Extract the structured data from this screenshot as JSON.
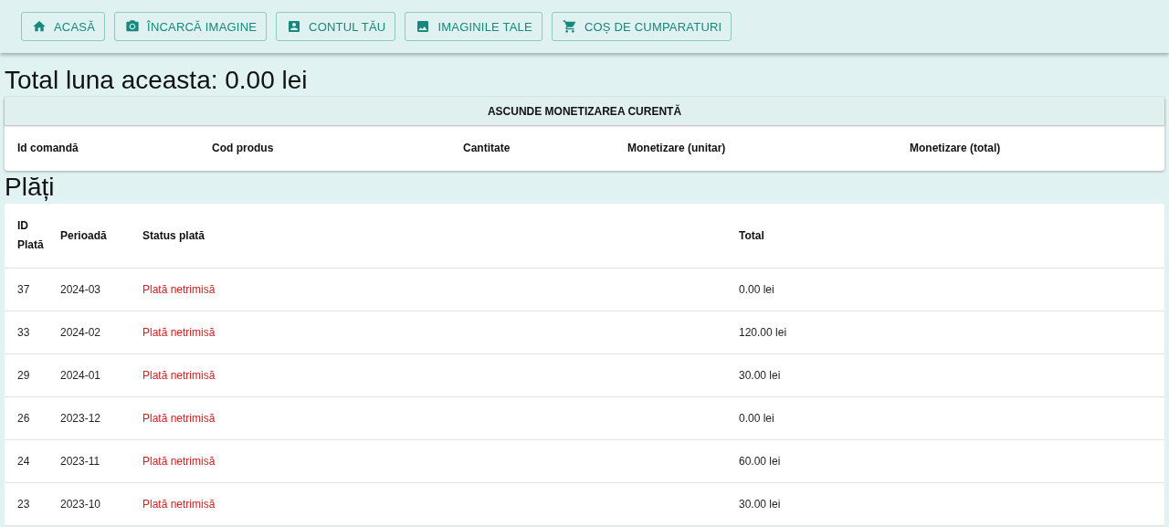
{
  "nav": [
    {
      "kind": "home",
      "label": "ACASĂ"
    },
    {
      "kind": "camera",
      "label": "ÎNCARCĂ IMAGINE"
    },
    {
      "kind": "account",
      "label": "CONTUL TĂU"
    },
    {
      "kind": "image",
      "label": "IMAGINILE TALE"
    },
    {
      "kind": "cart",
      "label": "COȘ DE CUMPARATURI"
    }
  ],
  "total_title": "Total luna aceasta: 0.00 lei",
  "monetization": {
    "toggle_label": "ASCUNDE MONETIZAREA CURENTĂ",
    "columns": [
      "Id comandă",
      "Cod produs",
      "Cantitate",
      "Monetizare (unitar)",
      "Monetizare (total)"
    ]
  },
  "payments_title": "Plăți",
  "payments": {
    "columns": [
      "ID Plată",
      "Perioadă",
      "Status plată",
      "Total"
    ],
    "rows": [
      [
        "37",
        "2024-03",
        "Plată netrimisă",
        "0.00 lei"
      ],
      [
        "33",
        "2024-02",
        "Plată netrimisă",
        "120.00 lei"
      ],
      [
        "29",
        "2024-01",
        "Plată netrimisă",
        "30.00 lei"
      ],
      [
        "26",
        "2023-12",
        "Plată netrimisă",
        "0.00 lei"
      ],
      [
        "24",
        "2023-11",
        "Plată netrimisă",
        "60.00 lei"
      ],
      [
        "23",
        "2023-10",
        "Plată netrimisă",
        "30.00 lei"
      ]
    ]
  }
}
